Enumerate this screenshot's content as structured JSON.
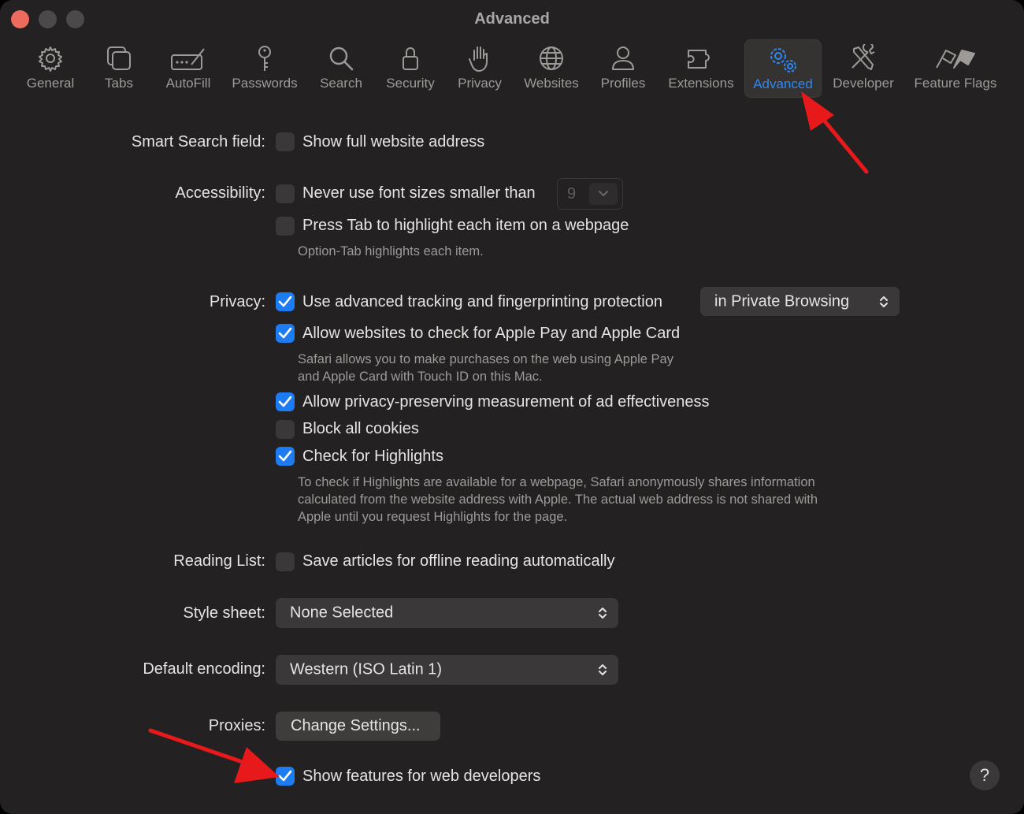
{
  "window": {
    "title": "Advanced"
  },
  "toolbar": {
    "tabs": [
      {
        "label": "General",
        "icon": "gear-icon"
      },
      {
        "label": "Tabs",
        "icon": "tabs-icon"
      },
      {
        "label": "AutoFill",
        "icon": "autofill-icon"
      },
      {
        "label": "Passwords",
        "icon": "key-icon"
      },
      {
        "label": "Search",
        "icon": "magnifier-icon"
      },
      {
        "label": "Security",
        "icon": "lock-icon"
      },
      {
        "label": "Privacy",
        "icon": "hand-icon"
      },
      {
        "label": "Websites",
        "icon": "globe-icon"
      },
      {
        "label": "Profiles",
        "icon": "person-icon"
      },
      {
        "label": "Extensions",
        "icon": "puzzle-icon"
      },
      {
        "label": "Advanced",
        "icon": "gears-icon",
        "selected": true
      },
      {
        "label": "Developer",
        "icon": "tools-icon"
      },
      {
        "label": "Feature Flags",
        "icon": "flags-icon"
      }
    ]
  },
  "settings": {
    "smart_search": {
      "label": "Smart Search field:",
      "show_full_address": {
        "text": "Show full website address",
        "checked": false
      }
    },
    "accessibility": {
      "label": "Accessibility:",
      "min_font": {
        "text": "Never use font sizes smaller than",
        "checked": false,
        "value": "9"
      },
      "press_tab": {
        "text": "Press Tab to highlight each item on a webpage",
        "checked": false
      },
      "help": "Option-Tab highlights each item."
    },
    "privacy": {
      "label": "Privacy:",
      "tracking": {
        "text": "Use advanced tracking and fingerprinting protection",
        "checked": true,
        "popup": "in Private Browsing"
      },
      "apple_pay": {
        "text": "Allow websites to check for Apple Pay and Apple Card",
        "checked": true
      },
      "apple_pay_help_1": "Safari allows you to make purchases on the web using Apple Pay",
      "apple_pay_help_2": "and Apple Card with Touch ID on this Mac.",
      "ad_measurement": {
        "text": "Allow privacy-preserving measurement of ad effectiveness",
        "checked": true
      },
      "block_cookies": {
        "text": "Block all cookies",
        "checked": false
      },
      "highlights": {
        "text": "Check for Highlights",
        "checked": true
      },
      "highlights_help_1": "To check if Highlights are available for a webpage, Safari anonymously shares information",
      "highlights_help_2": "calculated from the website address with Apple. The actual web address is not shared with",
      "highlights_help_3": "Apple until you request Highlights for the page."
    },
    "reading_list": {
      "label": "Reading List:",
      "save_offline": {
        "text": "Save articles for offline reading automatically",
        "checked": false
      }
    },
    "style_sheet": {
      "label": "Style sheet:",
      "value": "None Selected"
    },
    "encoding": {
      "label": "Default encoding:",
      "value": "Western (ISO Latin 1)"
    },
    "proxies": {
      "label": "Proxies:",
      "button": "Change Settings..."
    },
    "web_dev": {
      "text": "Show features for web developers",
      "checked": true
    }
  },
  "help_button": "?",
  "colors": {
    "accent": "#1e7cf2",
    "annotation_arrow": "#e8191b",
    "background": "#232121"
  }
}
